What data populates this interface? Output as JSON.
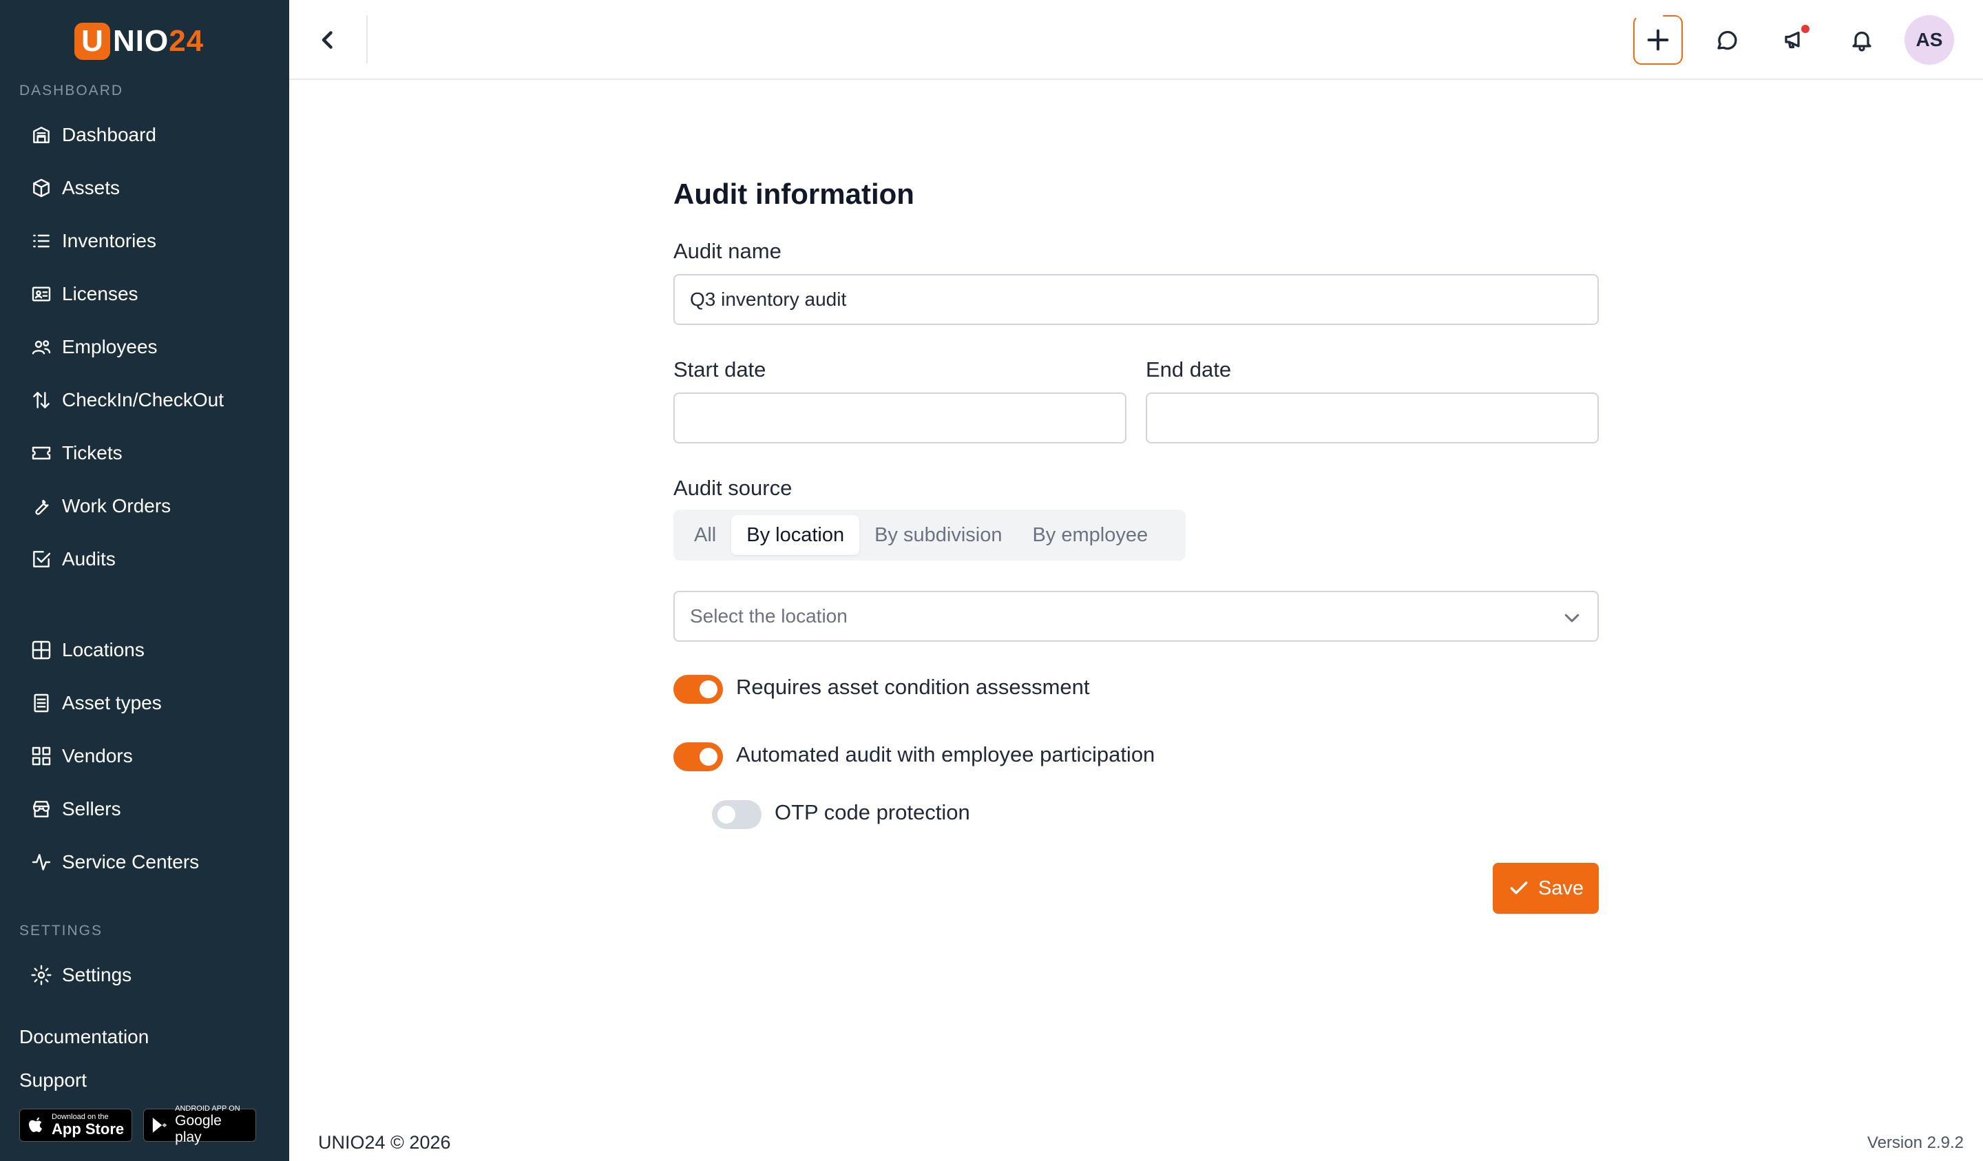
{
  "brand": {
    "logo_letter": "U",
    "logo_text": "NIO",
    "logo_num": "24"
  },
  "sidebar": {
    "section_dashboard": "DASHBOARD",
    "items": [
      {
        "label": "Dashboard",
        "icon": "building-icon"
      },
      {
        "label": "Assets",
        "icon": "box-icon"
      },
      {
        "label": "Inventories",
        "icon": "list-icon"
      },
      {
        "label": "Licenses",
        "icon": "id-card-icon"
      },
      {
        "label": "Employees",
        "icon": "users-icon"
      },
      {
        "label": "CheckIn/CheckOut",
        "icon": "arrows-up-down-icon"
      },
      {
        "label": "Tickets",
        "icon": "ticket-icon"
      },
      {
        "label": "Work Orders",
        "icon": "wrench-icon"
      },
      {
        "label": "Audits",
        "icon": "checkbox-icon"
      }
    ],
    "items2": [
      {
        "label": "Locations",
        "icon": "grid-icon"
      },
      {
        "label": "Asset types",
        "icon": "document-icon"
      },
      {
        "label": "Vendors",
        "icon": "apps-icon"
      },
      {
        "label": "Sellers",
        "icon": "store-icon"
      },
      {
        "label": "Service Centers",
        "icon": "activity-icon"
      }
    ],
    "section_settings": "SETTINGS",
    "settings_label": "Settings",
    "documentation": "Documentation",
    "support": "Support",
    "app_store_small": "Download on the",
    "app_store_big": "App Store",
    "google_play_small": "ANDROID APP ON",
    "google_play_big": "Google play"
  },
  "topbar": {
    "avatar_initials": "AS"
  },
  "form": {
    "title": "Audit information",
    "audit_name_label": "Audit name",
    "audit_name_value": "Q3 inventory audit",
    "start_date_label": "Start date",
    "start_date_value": "",
    "end_date_label": "End date",
    "end_date_value": "",
    "audit_source_label": "Audit source",
    "source_options": [
      "All",
      "By location",
      "By subdivision",
      "By employee"
    ],
    "source_selected": "By location",
    "location_placeholder": "Select the location",
    "toggle_condition_label": "Requires asset condition assessment",
    "toggle_condition_on": true,
    "toggle_automated_label": "Automated audit with employee participation",
    "toggle_automated_on": true,
    "toggle_otp_label": "OTP code protection",
    "toggle_otp_on": false,
    "save_label": "Save"
  },
  "footer": {
    "copyright": "UNIO24 © 2026",
    "version": "Version 2.9.2"
  },
  "colors": {
    "accent": "#f06a14",
    "sidebar_bg": "#1b2e3c",
    "avatar_bg": "#ead7f1"
  }
}
